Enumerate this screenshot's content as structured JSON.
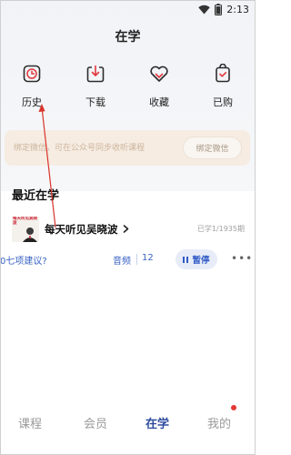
{
  "status_bar": {
    "time": "2:13"
  },
  "header": {
    "title": "在学"
  },
  "quick_actions": [
    {
      "label": "历史",
      "icon": "clock-icon"
    },
    {
      "label": "下载",
      "icon": "download-icon"
    },
    {
      "label": "收藏",
      "icon": "heart-icon"
    },
    {
      "label": "已购",
      "icon": "purchased-icon"
    }
  ],
  "bind_banner": {
    "text": "绑定微信，可在公众号同步收听课程",
    "button_label": "绑定微信"
  },
  "recent": {
    "section_title": "最近在学",
    "course": {
      "thumb_text": "每天听见吴晓波",
      "title": "每天听见吴晓波",
      "progress": "已学1/1935期"
    },
    "lesson": {
      "title": "0七项建议?",
      "type": "音频",
      "duration": "12",
      "pause_label": "暂停",
      "more_label": "•••"
    }
  },
  "tabs": [
    {
      "label": "课程",
      "active": false
    },
    {
      "label": "会员",
      "active": false
    },
    {
      "label": "在学",
      "active": true
    },
    {
      "label": "我的",
      "active": false,
      "badge": true
    }
  ],
  "colors": {
    "accent": "#2f4d9e",
    "link_blue": "#3a63c4",
    "icon_red": "#e0393e",
    "annotation_arrow": "#d9342b",
    "banner_bg": "#f6ece2"
  }
}
